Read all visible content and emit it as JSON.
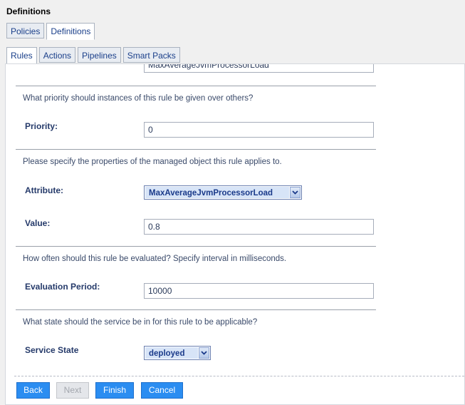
{
  "header": {
    "title": "Definitions"
  },
  "tabs_top": [
    {
      "label": "Policies",
      "active": false
    },
    {
      "label": "Definitions",
      "active": true
    }
  ],
  "tabs_sub": [
    {
      "label": "Rules",
      "active": true
    },
    {
      "label": "Actions",
      "active": false
    },
    {
      "label": "Pipelines",
      "active": false
    },
    {
      "label": "Smart Packs",
      "active": false
    }
  ],
  "form": {
    "top_field_value": "MaxAverageJvmProcessorLoad",
    "priority_question": "What priority should instances of this rule be given over others?",
    "priority_label": "Priority:",
    "priority_value": "0",
    "properties_question": "Please specify the properties of the managed object this rule applies to.",
    "attribute_label": "Attribute:",
    "attribute_value": "MaxAverageJvmProcessorLoad",
    "value_label": "Value:",
    "value_value": "0.8",
    "interval_question": "How often should this rule be evaluated? Specify interval in milliseconds.",
    "evaluation_label": "Evaluation Period:",
    "evaluation_value": "10000",
    "state_question": "What state should the service be in for this rule to be applicable?",
    "service_state_label": "Service State",
    "service_state_value": "deployed"
  },
  "buttons": {
    "back": "Back",
    "next": "Next",
    "finish": "Finish",
    "cancel": "Cancel"
  },
  "colors": {
    "button_primary": "#2b8df1",
    "select_highlight": "#d7e4f7",
    "link_text": "#1a3f8a"
  },
  "icons": {
    "dropdown": "chevron-down-icon"
  }
}
